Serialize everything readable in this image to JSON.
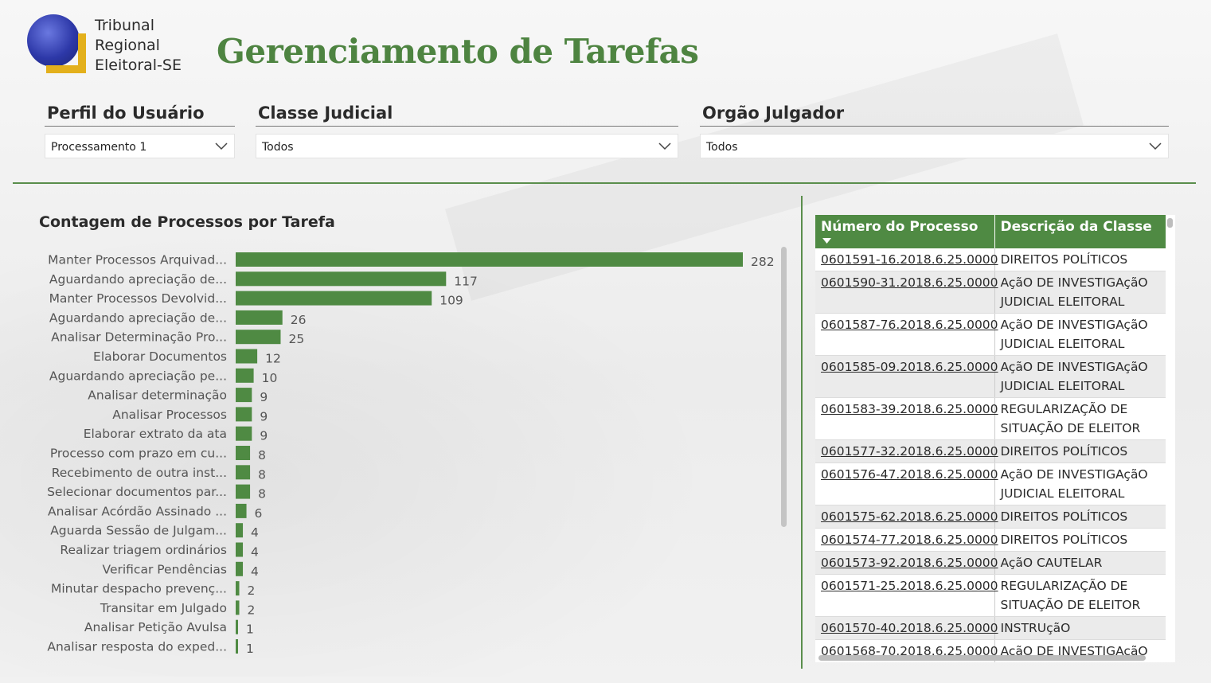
{
  "header": {
    "logo_lines": [
      "Tribunal",
      "Regional",
      "Eleitoral-SE"
    ],
    "title": "Gerenciamento de Tarefas"
  },
  "filters": [
    {
      "label": "Perfil do Usuário",
      "value": "Processamento 1"
    },
    {
      "label": "Classe Judicial",
      "value": "Todos"
    },
    {
      "label": "Orgão Julgador",
      "value": "Todos"
    }
  ],
  "colors": {
    "accent": "#4f8a43",
    "title_green": "#4e8441",
    "bar": "#4f8a43"
  },
  "chart_data": {
    "type": "bar",
    "orientation": "horizontal",
    "title": "Contagem de Processos por Tarefa",
    "categories": [
      "Manter Processos Arquivad...",
      "Aguardando apreciação de...",
      "Manter Processos Devolvid...",
      "Aguardando apreciação de...",
      "Analisar Determinação Pro...",
      "Elaborar Documentos",
      "Aguardando apreciação pe...",
      "Analisar determinação",
      "Analisar Processos",
      "Elaborar extrato da ata",
      "Processo com prazo em cu...",
      "Recebimento de outra inst...",
      "Selecionar documentos par...",
      "Analisar Acórdão Assinado ...",
      "Aguarda Sessão de Julgam...",
      "Realizar triagem ordinários",
      "Verificar Pendências",
      "Minutar despacho prevenç...",
      "Transitar em Julgado",
      "Analisar Petição Avulsa",
      "Analisar resposta do exped..."
    ],
    "values": [
      282,
      117,
      109,
      26,
      25,
      12,
      10,
      9,
      9,
      9,
      8,
      8,
      8,
      6,
      4,
      4,
      4,
      2,
      2,
      1,
      1
    ],
    "xlim": [
      0,
      282
    ],
    "grid": false,
    "data_labels": true
  },
  "table": {
    "columns": [
      "Número do Processo",
      "Descrição da Classe"
    ],
    "rows": [
      [
        "0601591-16.2018.6.25.0000",
        "DIREITOS POLÍTICOS"
      ],
      [
        "0601590-31.2018.6.25.0000",
        "AçãO DE INVESTIGAçãO JUDICIAL ELEITORAL"
      ],
      [
        "0601587-76.2018.6.25.0000",
        "AçãO DE INVESTIGAçãO JUDICIAL ELEITORAL"
      ],
      [
        "0601585-09.2018.6.25.0000",
        "AçãO DE INVESTIGAçãO JUDICIAL ELEITORAL"
      ],
      [
        "0601583-39.2018.6.25.0000",
        "REGULARIZAÇÃO DE SITUAÇÃO DE ELEITOR"
      ],
      [
        "0601577-32.2018.6.25.0000",
        "DIREITOS POLÍTICOS"
      ],
      [
        "0601576-47.2018.6.25.0000",
        "AçãO DE INVESTIGAçãO JUDICIAL ELEITORAL"
      ],
      [
        "0601575-62.2018.6.25.0000",
        "DIREITOS POLÍTICOS"
      ],
      [
        "0601574-77.2018.6.25.0000",
        "DIREITOS POLÍTICOS"
      ],
      [
        "0601573-92.2018.6.25.0000",
        "AçãO CAUTELAR"
      ],
      [
        "0601571-25.2018.6.25.0000",
        "REGULARIZAÇÃO DE SITUAÇÃO DE ELEITOR"
      ],
      [
        "0601570-40.2018.6.25.0000",
        "INSTRUçãO"
      ],
      [
        "0601568-70.2018.6.25.0000",
        "AçãO DE INVESTIGAçãO JUDICIAL ELEITORAL"
      ]
    ]
  }
}
